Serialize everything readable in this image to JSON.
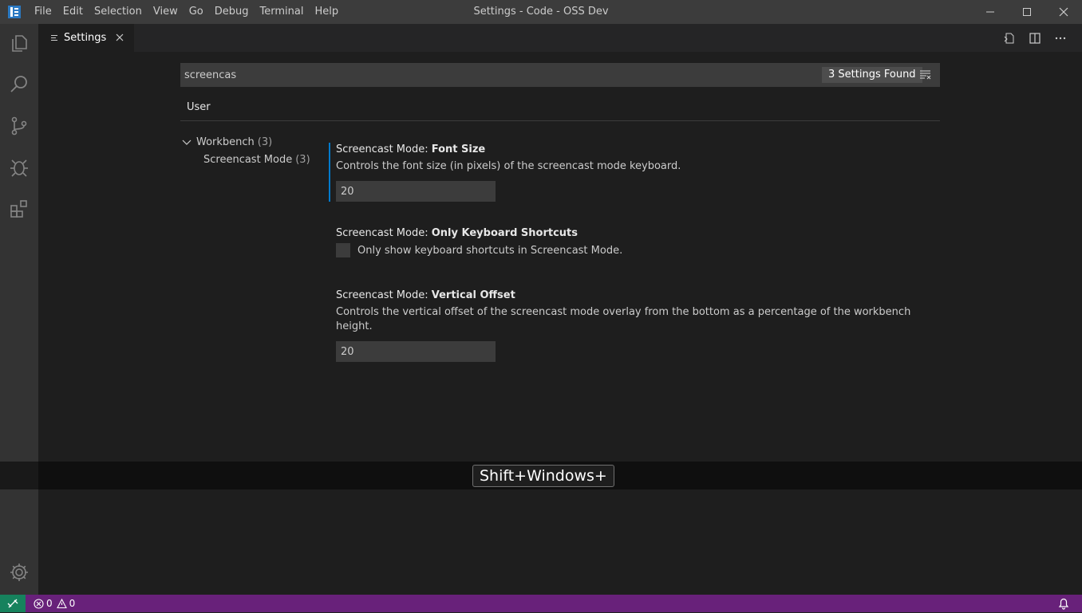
{
  "titlebar": {
    "menu": [
      "File",
      "Edit",
      "Selection",
      "View",
      "Go",
      "Debug",
      "Terminal",
      "Help"
    ],
    "window_title": "Settings - Code - OSS Dev"
  },
  "activitybar": {
    "icons": [
      "explorer-icon",
      "search-icon",
      "source-control-icon",
      "debug-icon",
      "extensions-icon"
    ],
    "bottom_icon": "gear-icon"
  },
  "tab": {
    "label": "Settings"
  },
  "search": {
    "value": "screencas",
    "result_count": "3 Settings Found"
  },
  "scope": {
    "active": "User"
  },
  "toc": [
    {
      "label": "Workbench",
      "count": "(3)"
    },
    {
      "label": "Screencast Mode",
      "count": "(3)"
    }
  ],
  "settings": [
    {
      "category": "Screencast Mode: ",
      "name": "Font Size",
      "description": "Controls the font size (in pixels) of the screencast mode keyboard.",
      "value": "20"
    },
    {
      "category": "Screencast Mode: ",
      "name": "Only Keyboard Shortcuts",
      "description": "Only show keyboard shortcuts in Screencast Mode.",
      "checked": false
    },
    {
      "category": "Screencast Mode: ",
      "name": "Vertical Offset",
      "description": "Controls the vertical offset of the screencast mode overlay from the bottom as a percentage of the workbench height.",
      "value": "20"
    }
  ],
  "screencast": {
    "keys": "Shift+Windows+"
  },
  "statusbar": {
    "errors": "0",
    "warnings": "0"
  },
  "colors": {
    "statusbar": "#68217a",
    "remote": "#16825d",
    "accent": "#007acc"
  }
}
